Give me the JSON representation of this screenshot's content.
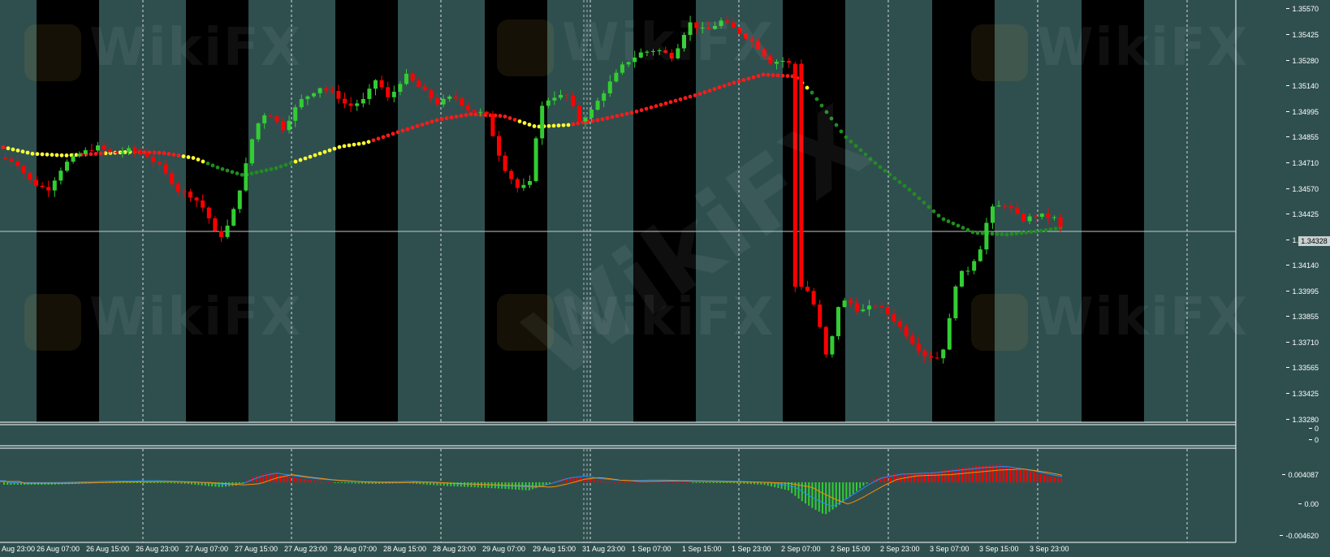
{
  "chart": {
    "symbol_colors": {
      "background": "#2f4f4f",
      "session_band": "#000000",
      "bull_candle": "#32cd32",
      "bear_candle": "#ff0000",
      "ma_red": "#ff1a1a",
      "ma_yellow": "#ffff33",
      "ma_green": "#228b22",
      "grid": "#ffffff"
    },
    "watermark_text": "WikiFX",
    "price_axis": {
      "labels": [
        "1.35570",
        "1.35425",
        "1.35280",
        "1.35140",
        "1.34995",
        "1.34855",
        "1.34710",
        "1.34570",
        "1.34425",
        "1.34280",
        "1.34140",
        "1.33995",
        "1.33855",
        "1.33710",
        "1.33565",
        "1.33425",
        "1.33280"
      ],
      "current_price": "1.34328"
    },
    "separator_panel": {
      "labels": [
        "0",
        "0"
      ]
    },
    "indicator_axis": {
      "labels": [
        "0.004087",
        "0.00",
        "-0.004620"
      ]
    },
    "time_axis": {
      "labels": [
        "Aug 23:00",
        "26 Aug 07:00",
        "26 Aug 15:00",
        "26 Aug 23:00",
        "27 Aug 07:00",
        "27 Aug 15:00",
        "27 Aug 23:00",
        "28 Aug 07:00",
        "28 Aug 15:00",
        "28 Aug 23:00",
        "29 Aug 07:00",
        "29 Aug 15:00",
        "31 Aug 23:00",
        "1 Sep 07:00",
        "1 Sep 15:00",
        "1 Sep 23:00",
        "2 Sep 07:00",
        "2 Sep 15:00",
        "2 Sep 23:00",
        "3 Sep 07:00",
        "3 Sep 15:00",
        "3 Sep 23:00"
      ]
    }
  }
}
